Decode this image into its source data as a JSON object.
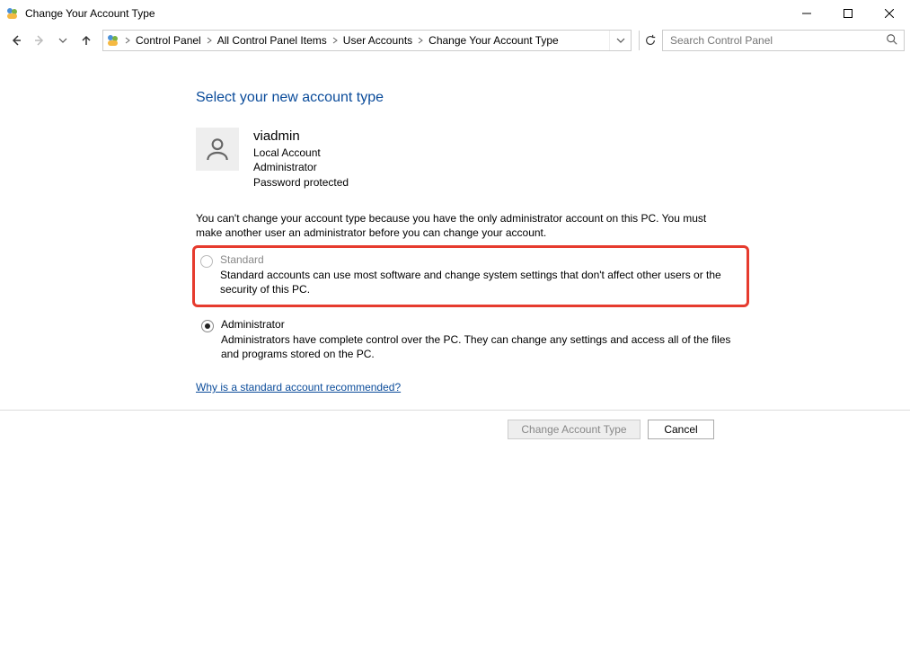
{
  "window": {
    "title": "Change Your Account Type"
  },
  "breadcrumb": {
    "items": [
      "Control Panel",
      "All Control Panel Items",
      "User Accounts",
      "Change Your Account Type"
    ]
  },
  "search": {
    "placeholder": "Search Control Panel"
  },
  "page": {
    "heading": "Select your new account type",
    "user": {
      "name": "viadmin",
      "type": "Local Account",
      "role": "Administrator",
      "pw": "Password protected"
    },
    "warning": "You can't change your account type because you have the only administrator account on this PC. You must make another user an administrator before you can change your account.",
    "options": {
      "standard": {
        "label": "Standard",
        "desc": "Standard accounts can use most software and change system settings that don't affect other users or the security of this PC.",
        "selected": false,
        "disabled": true,
        "highlighted": true
      },
      "administrator": {
        "label": "Administrator",
        "desc": "Administrators have complete control over the PC. They can change any settings and access all of the files and programs stored on the PC.",
        "selected": true,
        "disabled": false,
        "highlighted": false
      }
    },
    "help_link": "Why is a standard account recommended?"
  },
  "footer": {
    "primary": "Change Account Type",
    "secondary": "Cancel",
    "primary_disabled": true
  }
}
